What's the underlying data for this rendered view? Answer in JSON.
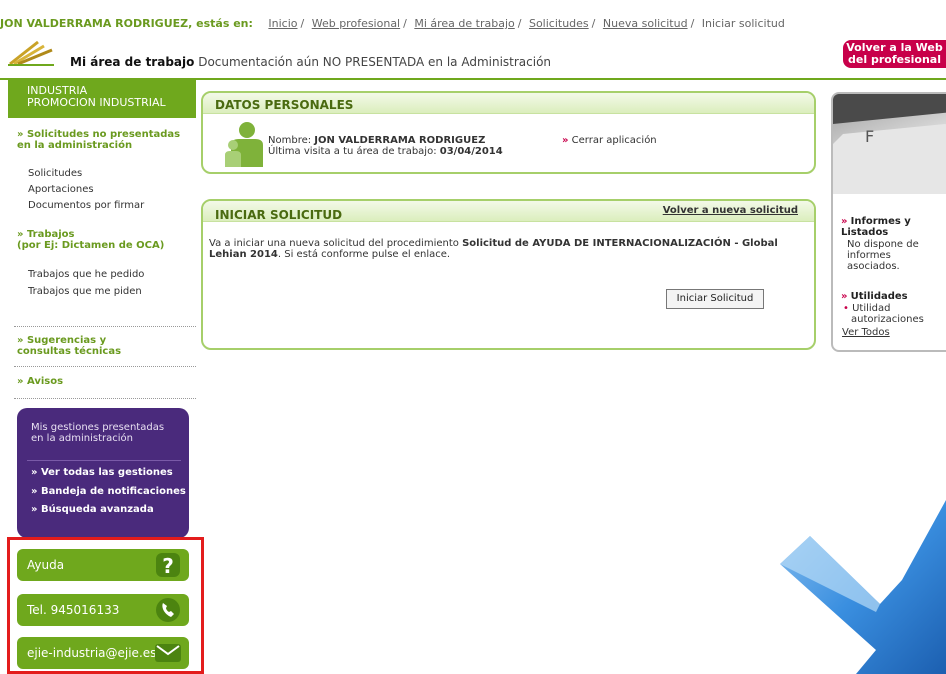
{
  "header": {
    "user_prefix": "JON VALDERRAMA RODRIGUEZ, estás en:",
    "breadcrumbs": [
      "Inicio",
      "Web profesional",
      "Mi área de trabajo",
      "Solicitudes",
      "Nueva solicitud"
    ],
    "current": "Iniciar solicitud",
    "area_title": "Mi área de trabajo",
    "area_desc": "Documentación aún NO PRESENTADA en la Administración",
    "volver_web_line1": "Volver a la Web",
    "volver_web_line2": "del profesional"
  },
  "sidebar": {
    "section_line1": "INDUSTRIA",
    "section_line2": "PROMOCION INDUSTRIAL",
    "no_presentadas_line1": "» Solicitudes no presentadas",
    "no_presentadas_line2": "en la administración",
    "items1": [
      "Solicitudes",
      "Aportaciones",
      "Documentos por firmar"
    ],
    "trabajos_line1": "» Trabajos",
    "trabajos_line2": "(por Ej: Dictamen de OCA)",
    "items2": [
      "Trabajos que he pedido",
      "Trabajos que me piden"
    ],
    "sugerencias_line1": "» Sugerencias y",
    "sugerencias_line2": "consultas técnicas",
    "avisos": "» Avisos",
    "gestiones_head1": "Mis gestiones presentadas",
    "gestiones_head2": "en la administración",
    "gestiones_links": [
      "» Ver todas las gestiones",
      "» Bandeja de notificaciones",
      "» Búsqueda avanzada"
    ],
    "ayuda": "Ayuda",
    "tel": "Tel. 945016133",
    "email": "ejie-industria@ejie.es"
  },
  "datos": {
    "title": "DATOS PERSONALES",
    "nombre_label": "Nombre:",
    "nombre_value": "JON VALDERRAMA RODRIGUEZ",
    "visita_label": "Última visita a tu área de trabajo:",
    "visita_value": "03/04/2014",
    "cerrar": "Cerrar aplicación"
  },
  "iniciar": {
    "title": "INICIAR SOLICITUD",
    "volver": "Volver a nueva solicitud",
    "text_pre": "Va a iniciar una nueva solicitud del procedimiento",
    "procedure": "Solicitud de AYUDA DE INTERNACIONALIZACIÓN - Global Lehian 2014",
    "text_post": ". Si está conforme pulse el enlace.",
    "button": "Iniciar Solicitud"
  },
  "right": {
    "informes_line1": "Informes y",
    "informes_line2": "Listados",
    "informes_text": [
      "No dispone de",
      "informes",
      "asociados."
    ],
    "utilidades": "Utilidades",
    "util_item1": "Utilidad",
    "util_item2": "autorizaciones",
    "ver_todos": "Ver Todos"
  },
  "colors": {
    "green": "#6fa81d",
    "purple": "#4a2a7c",
    "magenta": "#c8004a",
    "red_highlight": "#e31c1c"
  }
}
